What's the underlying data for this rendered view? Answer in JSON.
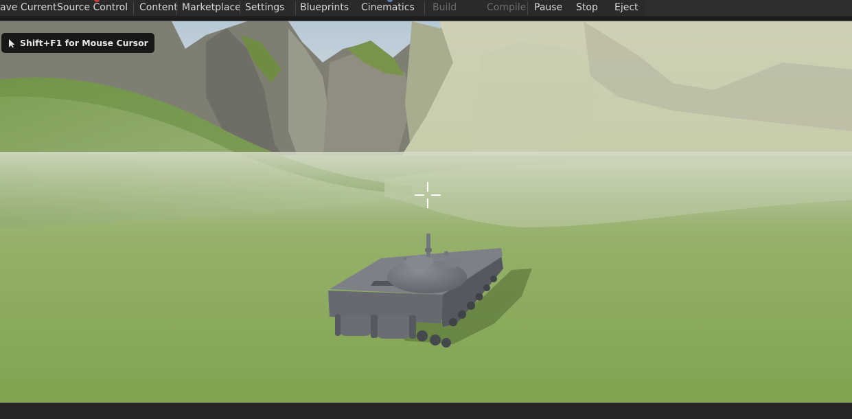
{
  "toolbar": {
    "items": [
      {
        "label": "ave Current",
        "enabled": true
      },
      {
        "label": "Source Control",
        "enabled": true
      },
      {
        "label": "Content",
        "enabled": true
      },
      {
        "label": "Marketplace",
        "enabled": true
      },
      {
        "label": "Settings",
        "enabled": true
      },
      {
        "label": "Blueprints",
        "enabled": true
      },
      {
        "label": "Cinematics",
        "enabled": true
      },
      {
        "label": "Build",
        "enabled": false
      },
      {
        "label": "Compile",
        "enabled": false
      },
      {
        "label": "Pause",
        "enabled": true
      },
      {
        "label": "Stop",
        "enabled": true
      },
      {
        "label": "Eject",
        "enabled": true
      }
    ]
  },
  "viewport": {
    "hint_text": "Shift+F1 for Mouse Cursor",
    "hint_icon": "mouse-pointer-icon",
    "crosshair_icon": "crosshair-icon",
    "scene": "tank-on-grass-terrain"
  },
  "colors": {
    "toolbar_bg": "#2a2a2a",
    "ground": "#8eae5e",
    "sky": "#c9d6dc",
    "mountain": "#8a8a80",
    "tank": "#6e7178"
  }
}
